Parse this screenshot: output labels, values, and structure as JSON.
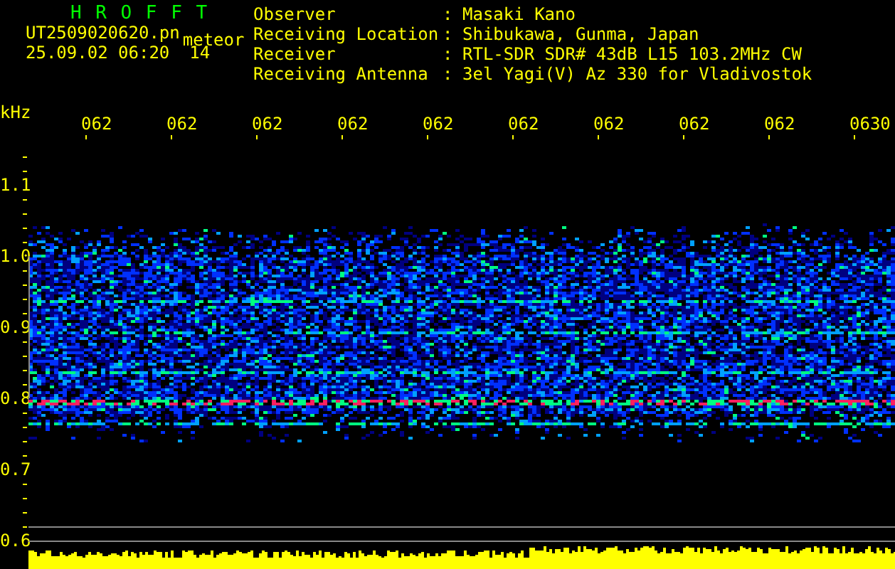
{
  "header": {
    "title": "H R O F F T",
    "filename": "UT2509020620.pn",
    "mode": "meteor",
    "datetime": "25.09.02 06:20",
    "count": "14"
  },
  "station": [
    {
      "label": "Observer",
      "colon": ":",
      "value": "Masaki Kano"
    },
    {
      "label": "Receiving Location",
      "colon": ":",
      "value": "Shibukawa, Gunma, Japan"
    },
    {
      "label": "Receiver",
      "colon": ":",
      "value": "RTL-SDR SDR# 43dB L15 103.2MHz CW"
    },
    {
      "label": "Receiving Antenna",
      "colon": ":",
      "value": "3el Yagi(V) Az 330 for Vladivostok"
    }
  ],
  "axis": {
    "unit": "kHz",
    "time_labels": [
      "062",
      "062",
      "062",
      "062",
      "062",
      "062",
      "062",
      "062",
      "062",
      "0630"
    ],
    "freq_labels": [
      "1.1",
      "1.0",
      "0.9",
      "0.8",
      "0.7",
      "0.6"
    ]
  }
}
